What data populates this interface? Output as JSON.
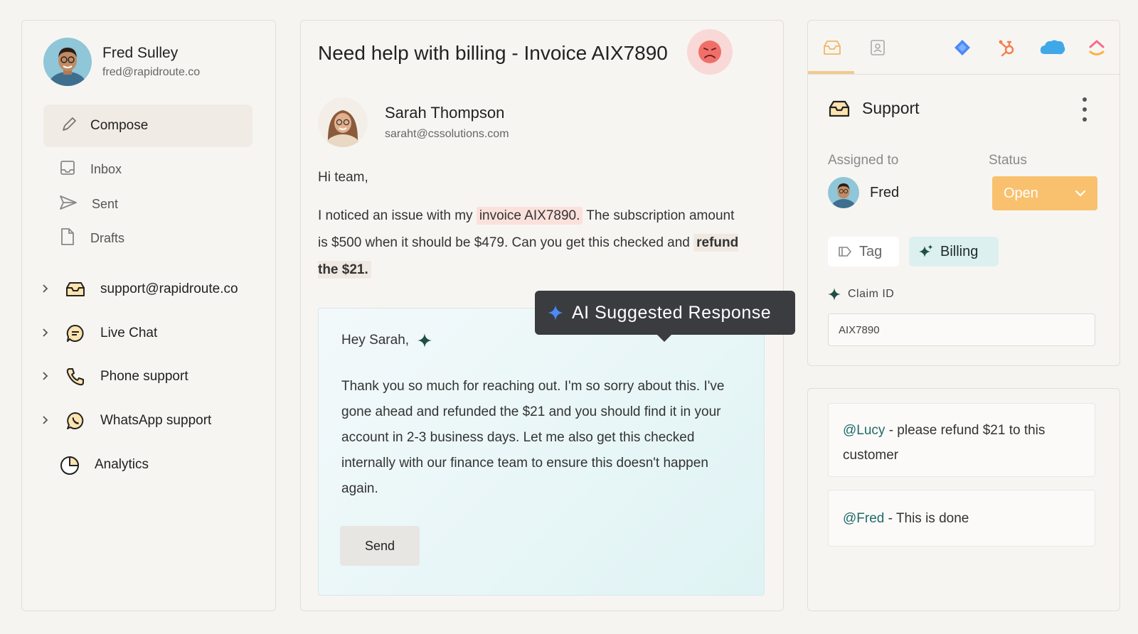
{
  "left": {
    "user": {
      "name": "Fred Sulley",
      "email": "fred@rapidroute.co"
    },
    "compose_label": "Compose",
    "nav": [
      {
        "label": "Inbox",
        "icon": "inbox-tray-icon"
      },
      {
        "label": "Sent",
        "icon": "paper-plane-icon"
      },
      {
        "label": "Drafts",
        "icon": "document-icon"
      }
    ],
    "channels": [
      {
        "label": "support@rapidroute.co",
        "icon": "inbox-icon"
      },
      {
        "label": "Live Chat",
        "icon": "chat-bubble-icon"
      },
      {
        "label": "Phone support",
        "icon": "phone-icon"
      },
      {
        "label": "WhatsApp support",
        "icon": "whatsapp-icon"
      }
    ],
    "analytics_label": "Analytics"
  },
  "email": {
    "subject": "Need help with billing - Invoice AIX7890",
    "sentiment": "upset",
    "sender": {
      "name": "Sarah Thompson",
      "email": "saraht@cssolutions.com"
    },
    "salutation": "Hi team,",
    "body_part1": "I noticed an issue with my ",
    "body_highlight1": "invoice AIX7890.",
    "body_part2": " The subscription amount is $500 when it should be $479. Can you get this checked and ",
    "body_highlight2": "refund the $21."
  },
  "ai_response": {
    "tooltip": "AI Suggested Response",
    "greeting": "Hey Sarah,",
    "reply": "Thank you so much for reaching out. I'm so sorry about this. I've gone ahead and refunded the $21 and you should find it in your account in 2-3 business days. Let me also get this checked internally with our finance team to ensure this doesn't happen again.",
    "send_label": "Send"
  },
  "right": {
    "tabs": [
      "inbox-tab-icon",
      "contact-card-icon",
      "diamond-integration-icon",
      "hubspot-icon",
      "salesforce-icon",
      "clickup-icon"
    ],
    "inbox_title": "Support",
    "assigned_label": "Assigned to",
    "assignee": "Fred",
    "status_label": "Status",
    "status_value": "Open",
    "tag_label": "Tag",
    "billing_label": "Billing",
    "claim_label": "Claim ID",
    "claim_value": "AIX7890",
    "notes": [
      {
        "mention": "@Lucy",
        "text": " - please refund $21 to this customer"
      },
      {
        "mention": "@Fred",
        "text": " - This is done"
      }
    ]
  },
  "colors": {
    "accent_status": "#f9c16d",
    "billing_tag": "#dcf0ef",
    "mention": "#1f6b68",
    "tooltip_bg": "#3a3c3f",
    "ai_spark": "#3b7cf5"
  }
}
